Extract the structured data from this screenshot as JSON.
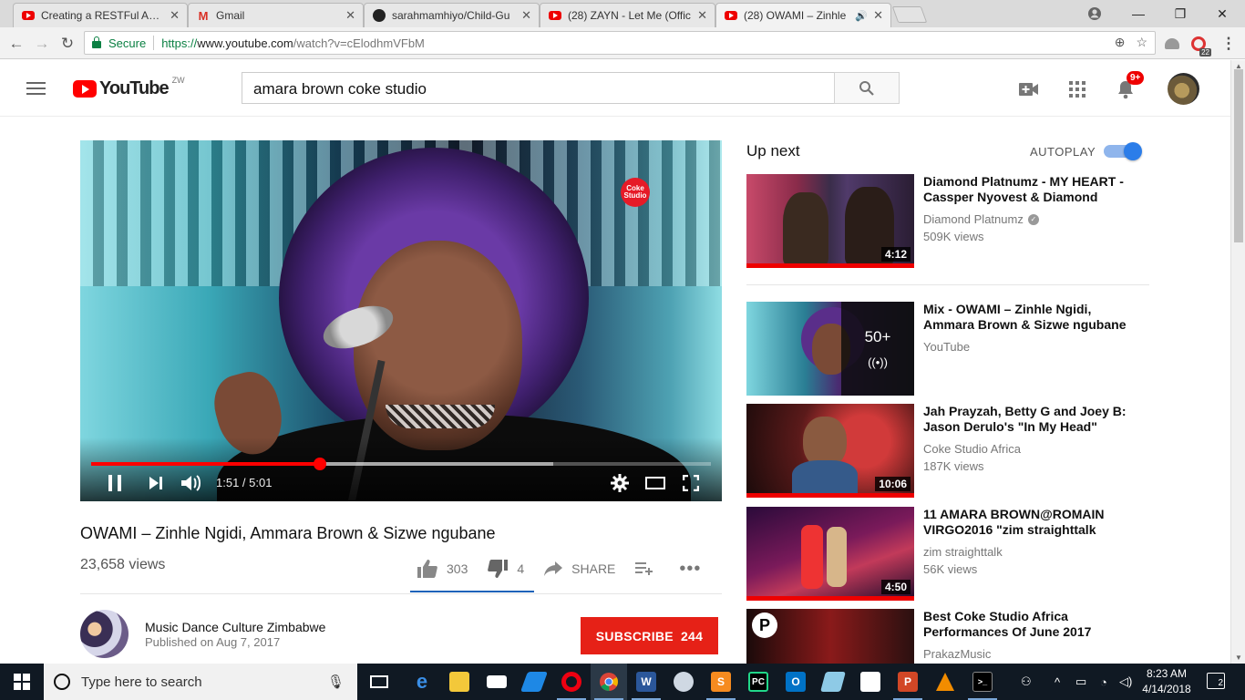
{
  "browser": {
    "tabs": [
      {
        "title": "Creating a RESTFul API in",
        "icon": "youtube-icon"
      },
      {
        "title": "Gmail",
        "icon": "gmail-icon"
      },
      {
        "title": "sarahmamhiyo/Child-Gu",
        "icon": "github-icon"
      },
      {
        "title": "(28) ZAYN - Let Me (Offic",
        "icon": "youtube-icon"
      },
      {
        "title": "(28) OWAMI – Zinhle",
        "icon": "youtube-icon"
      }
    ],
    "secure_label": "Secure",
    "url_scheme": "https://",
    "url_host": "www.youtube.com",
    "url_path": "/watch?v=cElodhmVFbM",
    "extension_badge": "22"
  },
  "youtube": {
    "logo_text": "YouTube",
    "region": "ZW",
    "search_query": "amara brown coke studio",
    "notification_count": "9+"
  },
  "player": {
    "current_time": "1:51",
    "duration": "5:01",
    "time_display": "1:51 / 5:01",
    "progress_fraction": 0.369,
    "buffered_fraction": 0.745,
    "watermark": "Coke Studio"
  },
  "video": {
    "title": "OWAMI – Zinhle Ngidi, Ammara Brown & Sizwe ngubane",
    "views": "23,658 views",
    "likes": "303",
    "dislikes": "4",
    "share_label": "SHARE",
    "channel": "Music Dance Culture Zimbabwe",
    "published": "Published on Aug 7, 2017",
    "subscribe_label": "SUBSCRIBE",
    "subscriber_count": "244"
  },
  "sidebar": {
    "up_next_label": "Up next",
    "autoplay_label": "AUTOPLAY",
    "autoplay_on": true,
    "recommendations": [
      {
        "title": "Diamond Platnumz - MY HEART - Cassper Nyovest & Diamond",
        "channel": "Diamond Platnumz",
        "verified": true,
        "views": "509K views",
        "duration": "4:12"
      },
      {
        "title": "Mix - OWAMI – Zinhle Ngidi, Ammara Brown & Sizwe ngubane",
        "channel": "YouTube",
        "mix_count": "50+"
      },
      {
        "title": "Jah Prayzah, Betty G and Joey B: Jason Derulo's \"In My Head\"",
        "channel": "Coke Studio Africa",
        "views": "187K views",
        "duration": "10:06"
      },
      {
        "title": "11 AMARA BROWN@ROMAIN VIRGO2016 \"zim straighttalk",
        "channel": "zim straighttalk",
        "views": "56K views",
        "duration": "4:50"
      },
      {
        "title": "Best Coke Studio Africa Performances Of June 2017",
        "channel": "PrakazMusic"
      }
    ]
  },
  "taskbar": {
    "search_placeholder": "Type here to search",
    "time": "8:23 AM",
    "date": "4/14/2018",
    "notifications": "2"
  }
}
